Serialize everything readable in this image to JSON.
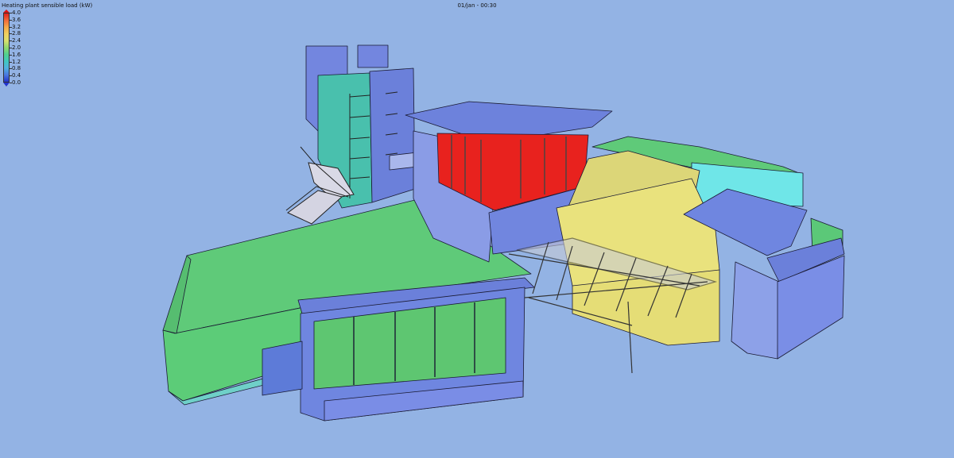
{
  "legend": {
    "title": "Heating plant sensible load (kW)",
    "ticks": [
      "4.0",
      "3.6",
      "3.2",
      "2.8",
      "2.4",
      "2.0",
      "1.6",
      "1.2",
      "0.8",
      "0.4",
      "0.0"
    ],
    "gradient": [
      "#e02020",
      "#f06a3a",
      "#f3a84a",
      "#f0d060",
      "#d8e070",
      "#90d870",
      "#50d090",
      "#40c8c0",
      "#50b0e0",
      "#4a78e0",
      "#2233cc"
    ]
  },
  "timestamp": "01/jan - 00:30",
  "colors": {
    "background": "#93b3e4",
    "zone_low": "#6f86e0",
    "zone_teal": "#45c4b0",
    "zone_cyan": "#6fe6e8",
    "zone_green": "#62c97a",
    "zone_yellow": "#e9e27d",
    "zone_red": "#e8221e"
  },
  "icons": [
    "colorbar-max-arrow-icon",
    "colorbar-min-arrow-icon"
  ]
}
